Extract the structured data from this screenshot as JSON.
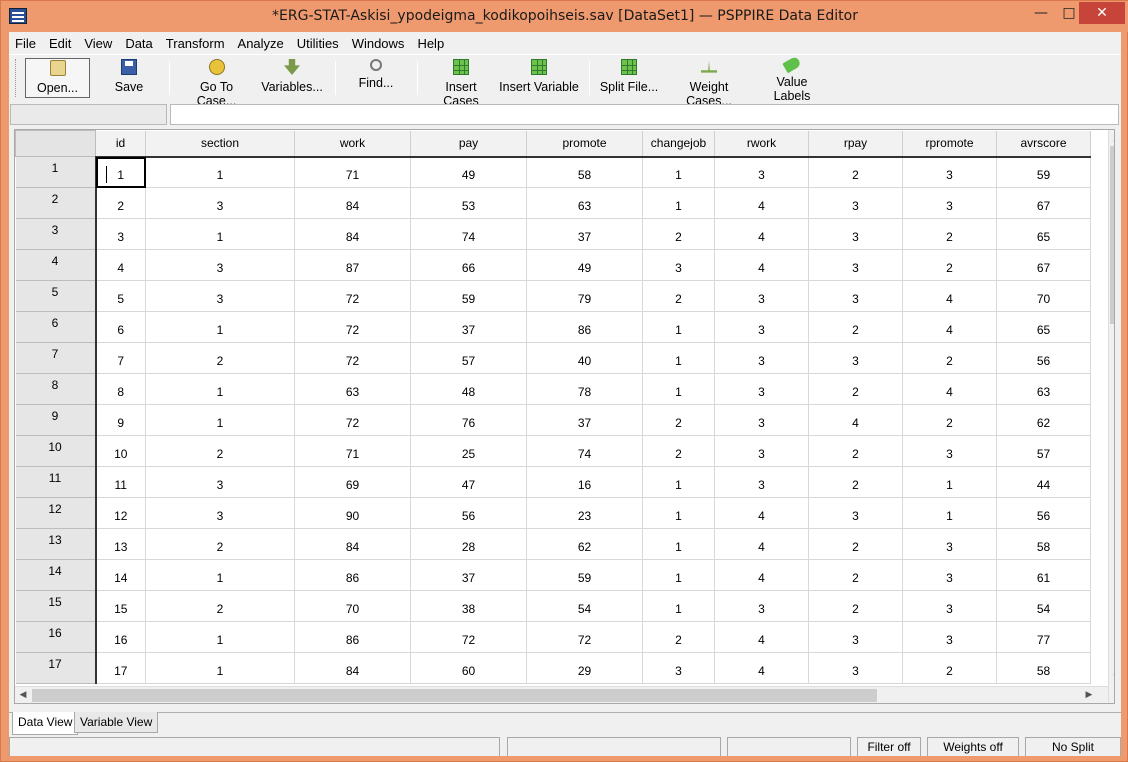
{
  "window": {
    "title": "*ERG-STAT-Askisi_ypodeigma_kodikopoihseis.sav [DataSet1] — PSPPIRE Data Editor",
    "minimize": "—",
    "maximize": "□",
    "close": "✕"
  },
  "menu": [
    "File",
    "Edit",
    "View",
    "Data",
    "Transform",
    "Analyze",
    "Utilities",
    "Windows",
    "Help"
  ],
  "toolbar": {
    "open": "Open...",
    "save": "Save",
    "goto_case": "Go To Case...",
    "variables": "Variables...",
    "find": "Find...",
    "insert_cases": "Insert Cases",
    "insert_variable": "Insert Variable",
    "split_file": "Split File...",
    "weight_cases": "Weight Cases...",
    "value_labels": "Value Labels"
  },
  "grid": {
    "columns": [
      "id",
      "section",
      "work",
      "pay",
      "promote",
      "changejob",
      "rwork",
      "rpay",
      "rpromote",
      "avrscore"
    ],
    "rows": [
      [
        "1",
        "1",
        "1",
        "71",
        "49",
        "58",
        "1",
        "3",
        "2",
        "3",
        "59"
      ],
      [
        "2",
        "2",
        "3",
        "84",
        "53",
        "63",
        "1",
        "4",
        "3",
        "3",
        "67"
      ],
      [
        "3",
        "3",
        "1",
        "84",
        "74",
        "37",
        "2",
        "4",
        "3",
        "2",
        "65"
      ],
      [
        "4",
        "4",
        "3",
        "87",
        "66",
        "49",
        "3",
        "4",
        "3",
        "2",
        "67"
      ],
      [
        "5",
        "5",
        "3",
        "72",
        "59",
        "79",
        "2",
        "3",
        "3",
        "4",
        "70"
      ],
      [
        "6",
        "6",
        "1",
        "72",
        "37",
        "86",
        "1",
        "3",
        "2",
        "4",
        "65"
      ],
      [
        "7",
        "7",
        "2",
        "72",
        "57",
        "40",
        "1",
        "3",
        "3",
        "2",
        "56"
      ],
      [
        "8",
        "8",
        "1",
        "63",
        "48",
        "78",
        "1",
        "3",
        "2",
        "4",
        "63"
      ],
      [
        "9",
        "9",
        "1",
        "72",
        "76",
        "37",
        "2",
        "3",
        "4",
        "2",
        "62"
      ],
      [
        "10",
        "10",
        "2",
        "71",
        "25",
        "74",
        "2",
        "3",
        "2",
        "3",
        "57"
      ],
      [
        "11",
        "11",
        "3",
        "69",
        "47",
        "16",
        "1",
        "3",
        "2",
        "1",
        "44"
      ],
      [
        "12",
        "12",
        "3",
        "90",
        "56",
        "23",
        "1",
        "4",
        "3",
        "1",
        "56"
      ],
      [
        "13",
        "13",
        "2",
        "84",
        "28",
        "62",
        "1",
        "4",
        "2",
        "3",
        "58"
      ],
      [
        "14",
        "14",
        "1",
        "86",
        "37",
        "59",
        "1",
        "4",
        "2",
        "3",
        "61"
      ],
      [
        "15",
        "15",
        "2",
        "70",
        "38",
        "54",
        "1",
        "3",
        "2",
        "3",
        "54"
      ],
      [
        "16",
        "16",
        "1",
        "86",
        "72",
        "72",
        "2",
        "4",
        "3",
        "3",
        "77"
      ],
      [
        "17",
        "17",
        "1",
        "84",
        "60",
        "29",
        "3",
        "4",
        "3",
        "2",
        "58"
      ]
    ]
  },
  "tabs": {
    "data_view": "Data View",
    "variable_view": "Variable View"
  },
  "status": {
    "filter": "Filter off",
    "weights": "Weights off",
    "split": "No Split"
  }
}
